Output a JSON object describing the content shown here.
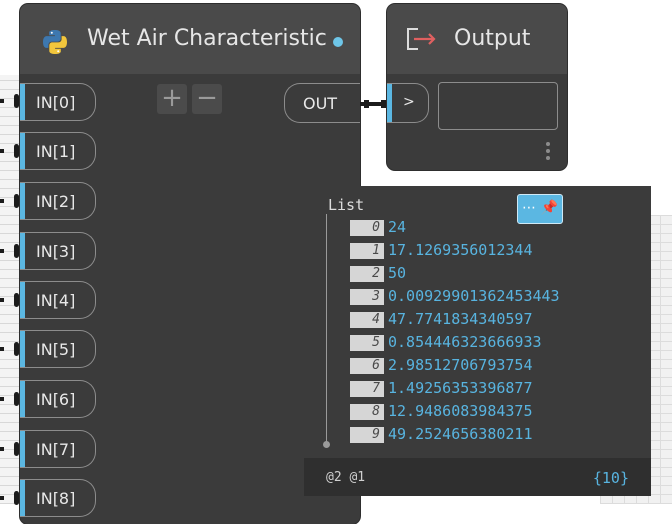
{
  "python_node": {
    "title": "Wet Air Characteristic",
    "inputs": [
      "IN[0]",
      "IN[1]",
      "IN[2]",
      "IN[3]",
      "IN[4]",
      "IN[5]",
      "IN[6]",
      "IN[7]",
      "IN[8]"
    ],
    "add_label": "+",
    "remove_label": "−",
    "output_label": "OUT"
  },
  "output_node": {
    "title": "Output",
    "input_label": ">"
  },
  "preview": {
    "list_label": "List",
    "pin_label": "⋯ 📌",
    "items": [
      {
        "index": "0",
        "value": "24"
      },
      {
        "index": "1",
        "value": "17.1269356012344"
      },
      {
        "index": "2",
        "value": "50"
      },
      {
        "index": "3",
        "value": "0.00929901362453443"
      },
      {
        "index": "4",
        "value": "47.7741834340597"
      },
      {
        "index": "5",
        "value": "0.854446323666933"
      },
      {
        "index": "6",
        "value": "2.98512706793754"
      },
      {
        "index": "7",
        "value": "1.49256353396877"
      },
      {
        "index": "8",
        "value": "12.9486083984375"
      },
      {
        "index": "9",
        "value": "49.2524656380211"
      }
    ],
    "levels": "@2 @1",
    "count": "{10}"
  },
  "colors": {
    "accent": "#5bb7e2",
    "node_body": "#3b3b3b",
    "node_header": "#4a4a4a",
    "value_text": "#58b4e0"
  }
}
